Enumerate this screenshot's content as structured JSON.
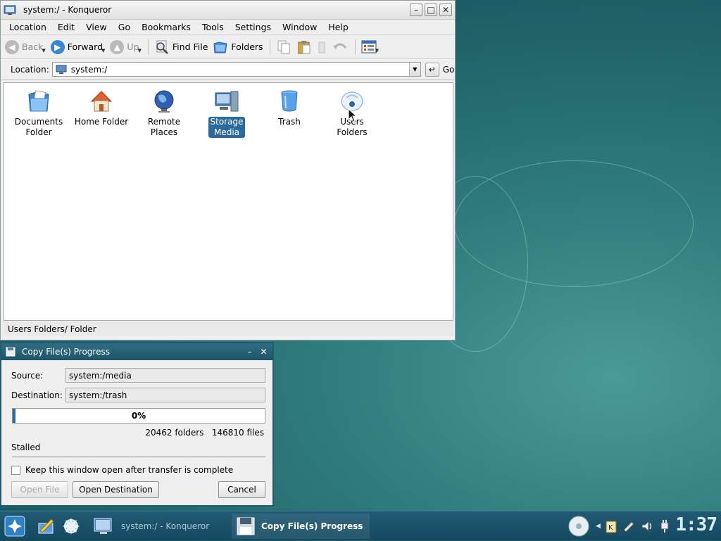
{
  "konqueror": {
    "title": "system:/ - Konqueror",
    "menu": [
      "Location",
      "Edit",
      "View",
      "Go",
      "Bookmarks",
      "Tools",
      "Settings",
      "Window",
      "Help"
    ],
    "toolbar": {
      "back": "Back",
      "forward": "Forward",
      "up": "Up",
      "find_file": "Find File",
      "folders": "Folders"
    },
    "location": {
      "label": "Location:",
      "value": "system:/",
      "go": "Go"
    },
    "icons": [
      {
        "line1": "Documents",
        "line2": "Folder"
      },
      {
        "line1": "Home Folder",
        "line2": ""
      },
      {
        "line1": "Remote",
        "line2": "Places"
      },
      {
        "line1": "Storage",
        "line2": "Media"
      },
      {
        "line1": "Trash",
        "line2": ""
      },
      {
        "line1": "Users Folders",
        "line2": ""
      }
    ],
    "status": "Users Folders/  Folder"
  },
  "dialog": {
    "title": "Copy File(s) Progress",
    "source_label": "Source:",
    "source_value": "system:/media",
    "destination_label": "Destination:",
    "destination_value": "system:/trash",
    "progress_text": "0%",
    "progress_fraction": 0.01,
    "counts": "20462 folders   146810 files",
    "state": "Stalled",
    "keep_open_label": "Keep this window open after transfer is complete",
    "open_file": "Open File",
    "open_destination": "Open Destination",
    "cancel": "Cancel"
  },
  "taskbar": {
    "tasks": [
      {
        "label": "system:/ - Konqueror"
      },
      {
        "label": "Copy File(s) Progress"
      }
    ],
    "clock": "1:37"
  },
  "colors": {
    "accent": "#2d6a9c",
    "dialog_titlebar": "#1e5468",
    "taskbar": "#154a61"
  }
}
